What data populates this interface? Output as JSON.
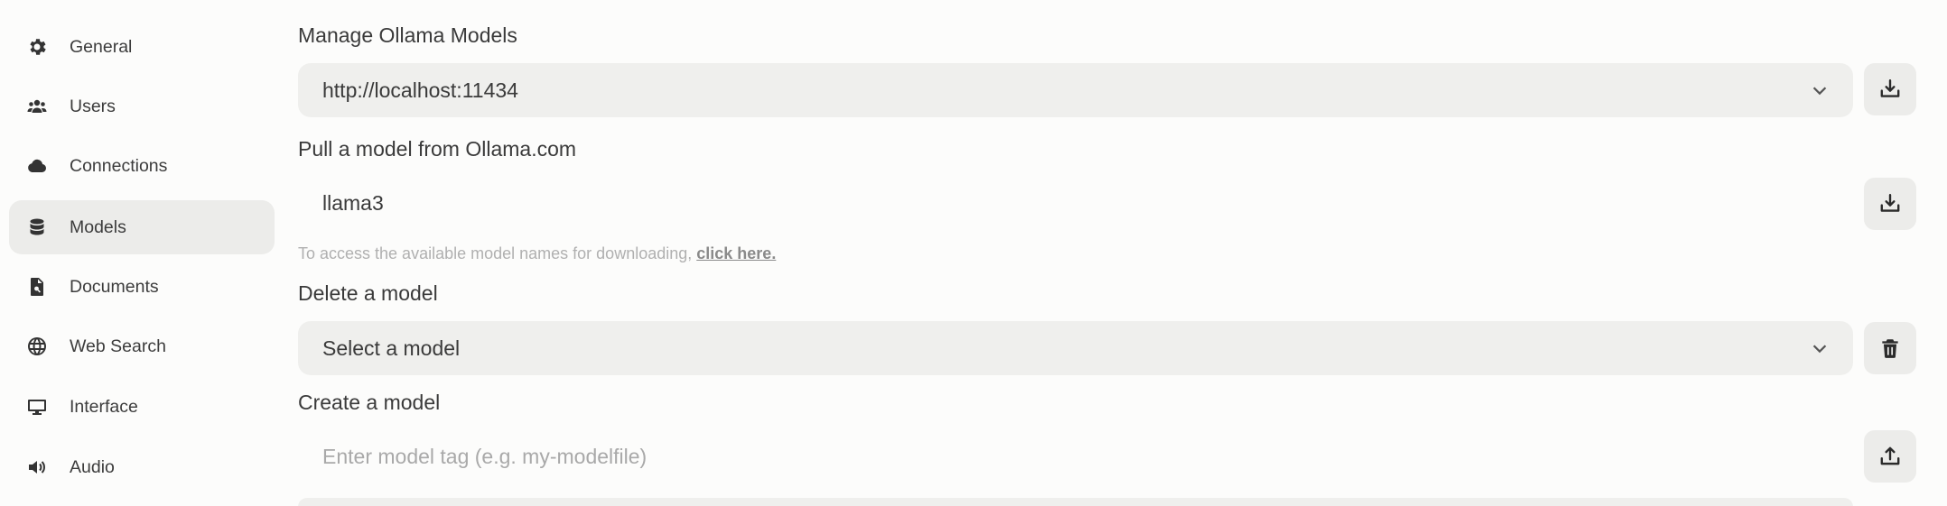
{
  "sidebar": {
    "items": [
      {
        "label": "General",
        "icon": "gear-icon"
      },
      {
        "label": "Users",
        "icon": "users-icon"
      },
      {
        "label": "Connections",
        "icon": "cloud-icon"
      },
      {
        "label": "Models",
        "icon": "database-icon"
      },
      {
        "label": "Documents",
        "icon": "document-search-icon"
      },
      {
        "label": "Web Search",
        "icon": "globe-icon"
      },
      {
        "label": "Interface",
        "icon": "monitor-icon"
      },
      {
        "label": "Audio",
        "icon": "speaker-icon"
      }
    ],
    "active": "Models"
  },
  "manage": {
    "title": "Manage Ollama Models",
    "url_value": "http://localhost:11434"
  },
  "pull": {
    "title": "Pull a model from Ollama.com",
    "input_value": "llama3",
    "hint_text": "To access the available model names for downloading, ",
    "hint_link": "click here."
  },
  "delete": {
    "title": "Delete a model",
    "select_value": "Select a model"
  },
  "create": {
    "title": "Create a model",
    "input_placeholder": "Enter model tag (e.g. my-modelfile)"
  }
}
